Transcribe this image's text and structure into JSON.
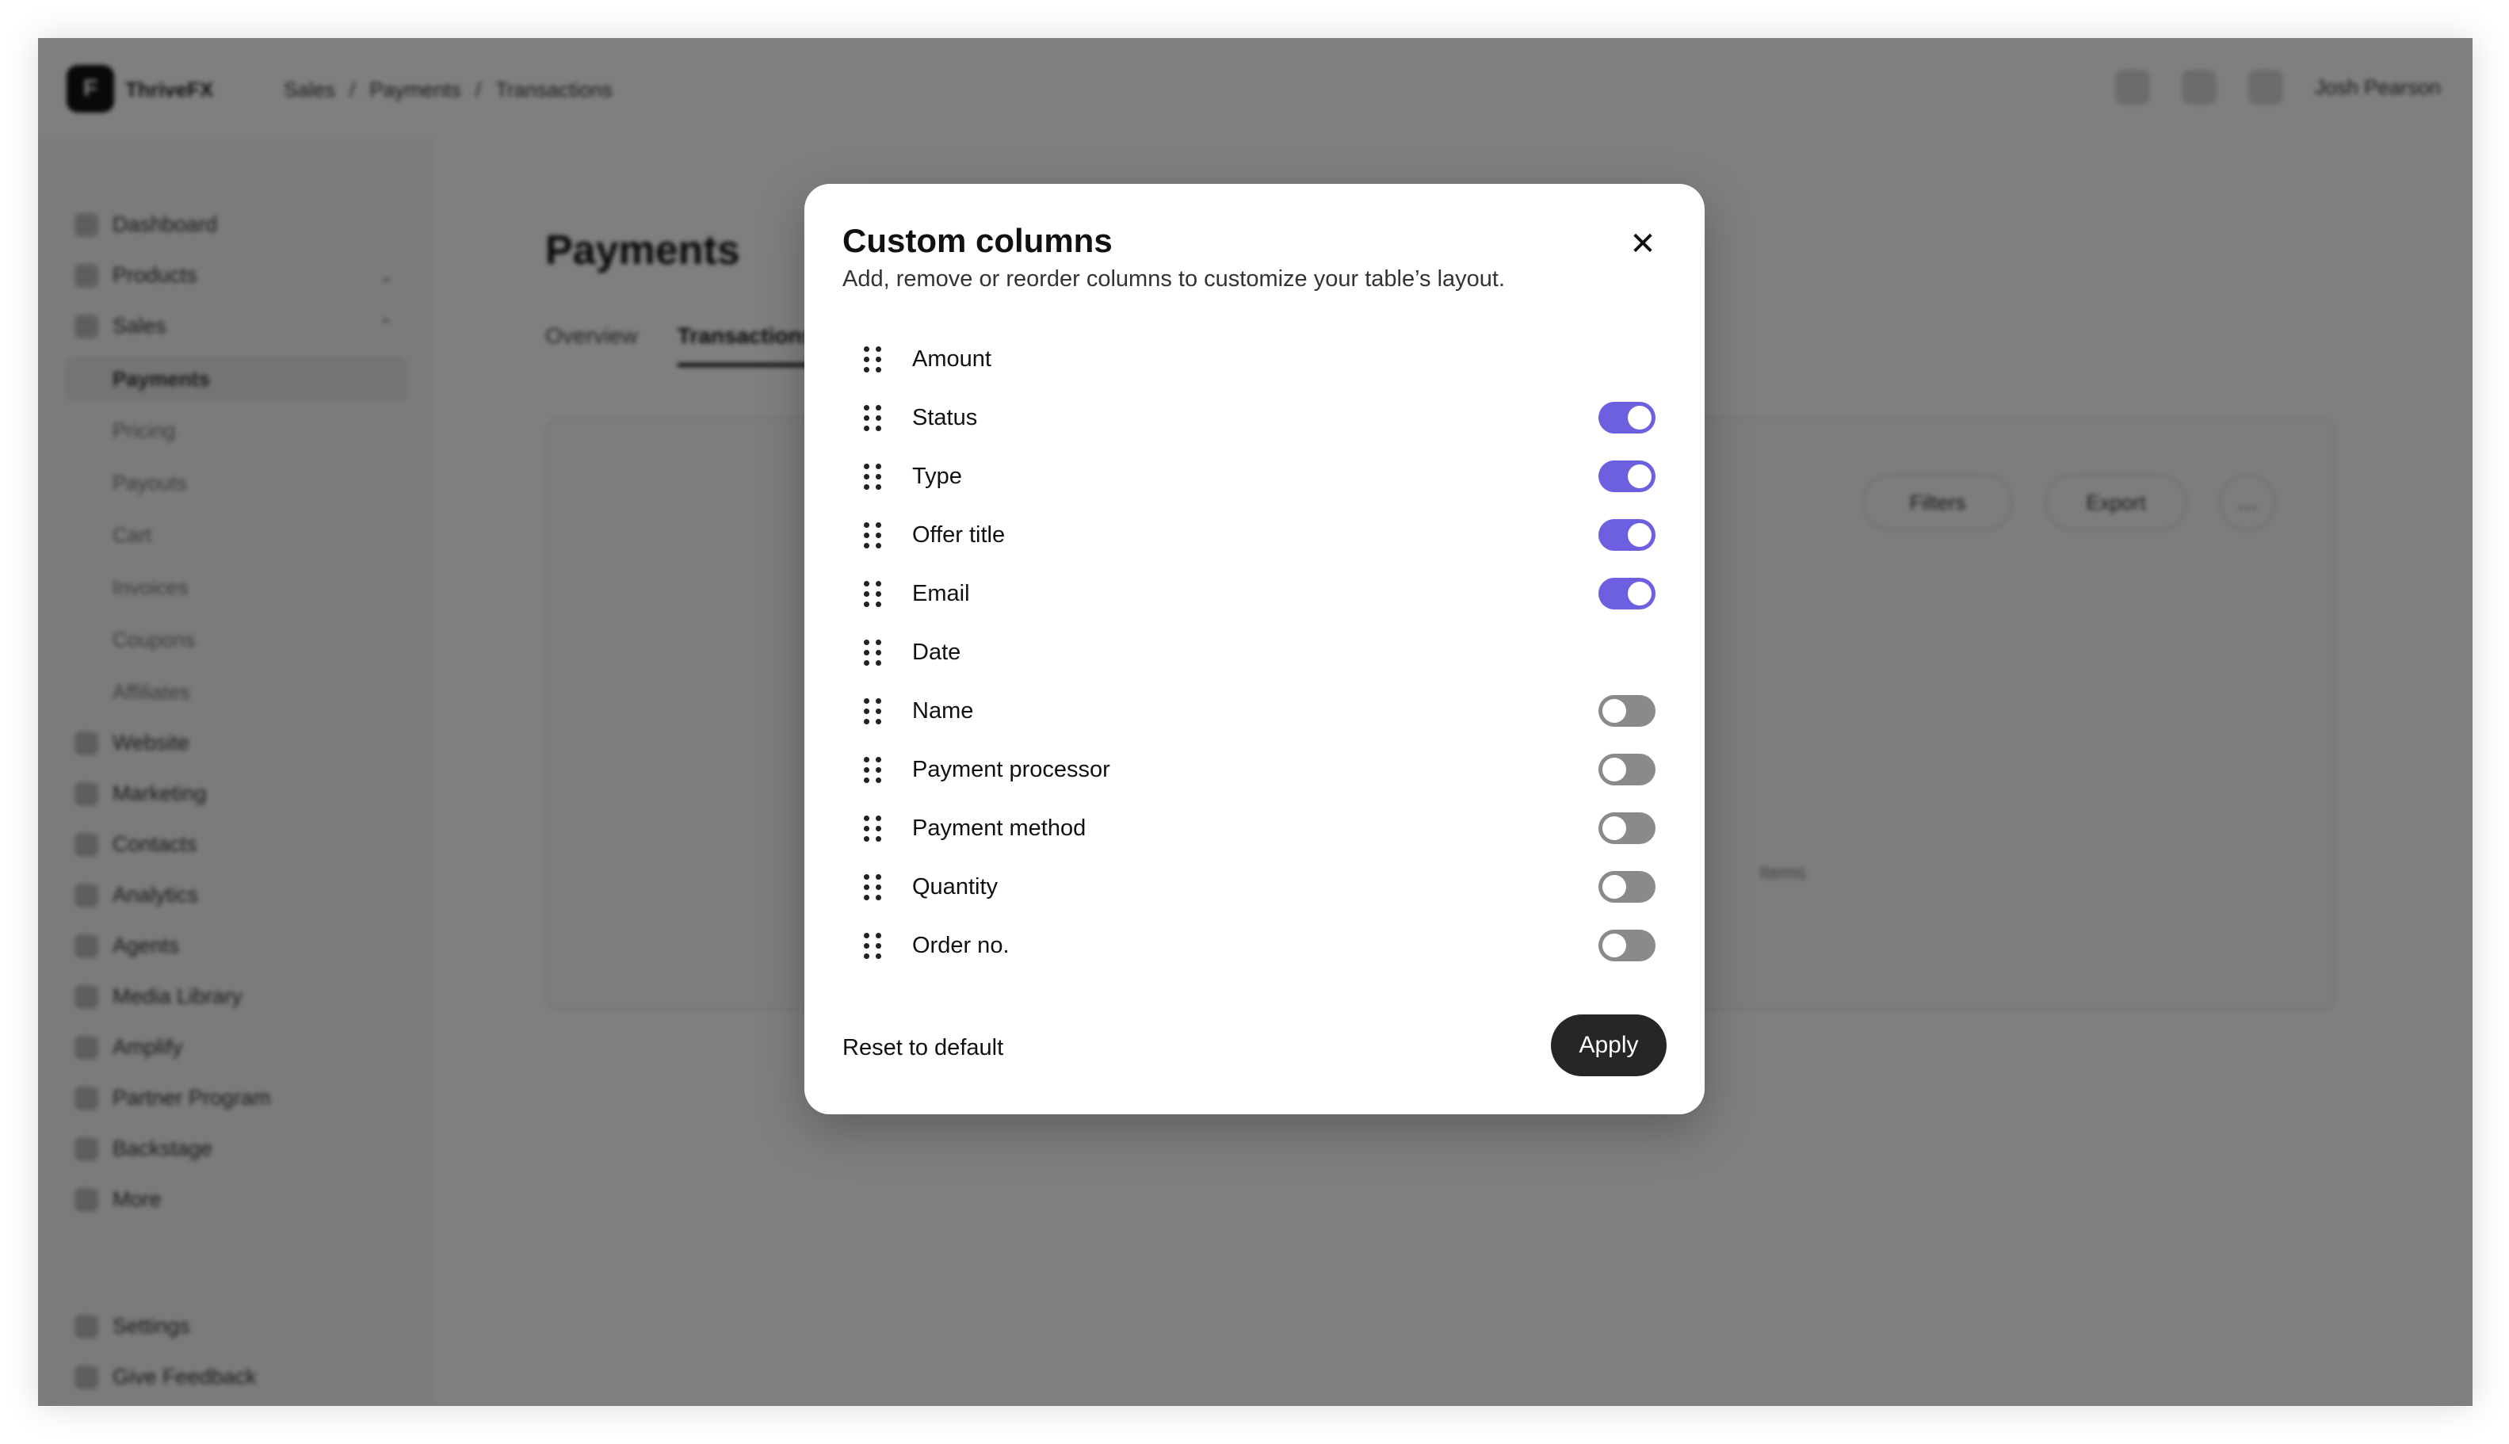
{
  "background": {
    "brand": "ThriveFX",
    "breadcrumb": [
      "Sales",
      "/",
      "Payments",
      "/",
      "Transactions"
    ],
    "user_name": "Josh Pearson",
    "sidebar": {
      "items": [
        {
          "label": "Dashboard"
        },
        {
          "label": "Products"
        },
        {
          "label": "Sales"
        }
      ],
      "sales_children": [
        "Payments",
        "Pricing",
        "Payouts",
        "Cart",
        "Invoices",
        "Coupons",
        "Affiliates"
      ],
      "more_items": [
        "Website",
        "Marketing",
        "Contacts",
        "Analytics",
        "Agents",
        "Media Library",
        "Amplify",
        "Partner Program",
        "Backstage",
        "More"
      ],
      "footer": [
        "Settings",
        "Give Feedback"
      ]
    },
    "page_title": "Payments",
    "tabs": [
      "Overview",
      "Transactions"
    ],
    "toolbar": {
      "filters": "Filters",
      "export": "Export",
      "more": "…"
    },
    "empty_hint": "Items"
  },
  "modal": {
    "title": "Custom columns",
    "subtitle": "Add, remove or reorder columns to customize your table’s layout.",
    "close_icon": "✕",
    "columns": [
      {
        "label": "Amount",
        "toggle": null
      },
      {
        "label": "Status",
        "toggle": true
      },
      {
        "label": "Type",
        "toggle": true
      },
      {
        "label": "Offer title",
        "toggle": true
      },
      {
        "label": "Email",
        "toggle": true
      },
      {
        "label": "Date",
        "toggle": null
      },
      {
        "label": "Name",
        "toggle": false
      },
      {
        "label": "Payment processor",
        "toggle": false
      },
      {
        "label": "Payment method",
        "toggle": false
      },
      {
        "label": "Quantity",
        "toggle": false
      },
      {
        "label": "Order no.",
        "toggle": false
      }
    ],
    "reset_label": "Reset to default",
    "apply_label": "Apply"
  },
  "colors": {
    "toggle_on": "#6c5fe0",
    "toggle_off": "#8a8a8a",
    "apply_button": "#262626",
    "overlay": "rgba(0,0,0,0.5)"
  }
}
